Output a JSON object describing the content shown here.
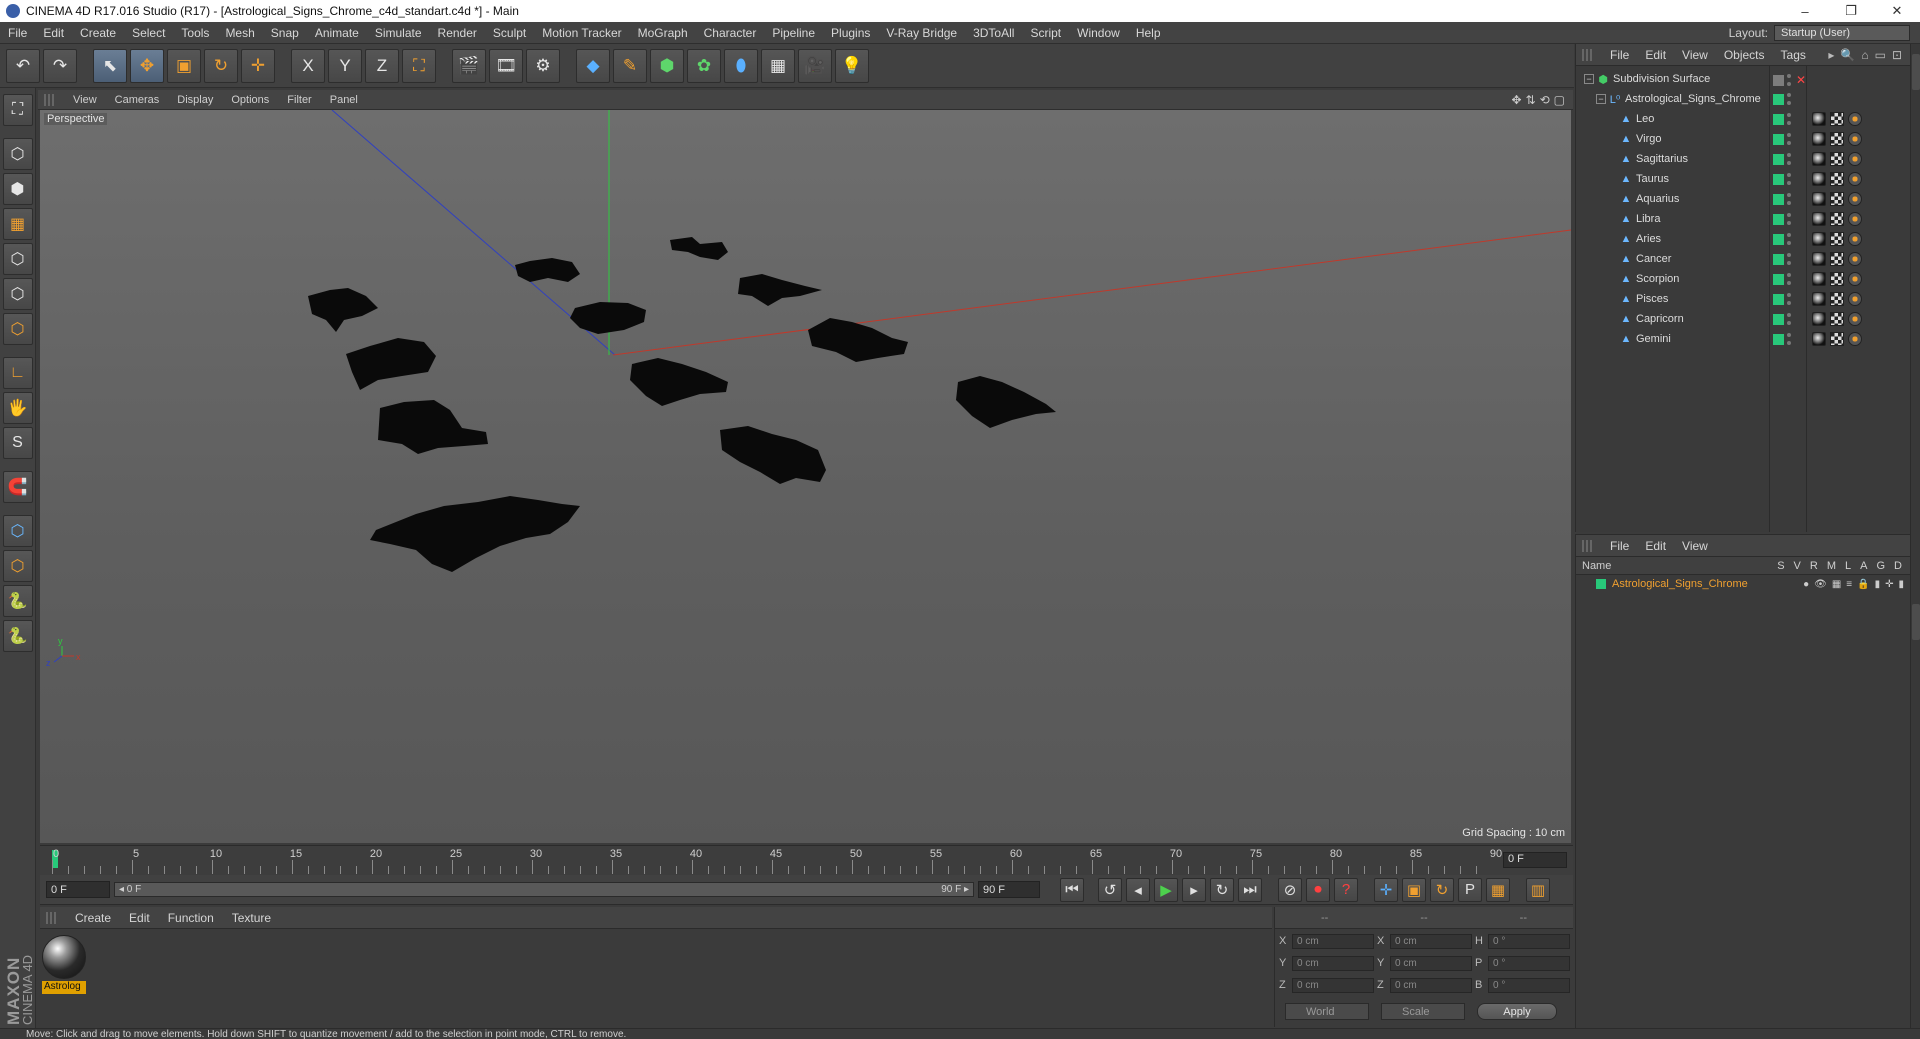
{
  "window": {
    "title": "CINEMA 4D R17.016 Studio (R17) - [Astrological_Signs_Chrome_c4d_standart.c4d *] - Main",
    "minimize_glyph": "–",
    "restore_glyph": "❐",
    "close_glyph": "✕"
  },
  "menubar": {
    "items": [
      "File",
      "Edit",
      "Create",
      "Select",
      "Tools",
      "Mesh",
      "Snap",
      "Animate",
      "Simulate",
      "Render",
      "Sculpt",
      "Motion Tracker",
      "MoGraph",
      "Character",
      "Pipeline",
      "Plugins",
      "V-Ray Bridge",
      "3DToAll",
      "Script",
      "Window",
      "Help"
    ],
    "layout_label": "Layout:",
    "layout_value": "Startup (User)"
  },
  "toolbar": {
    "undo": "↶",
    "redo": "↷",
    "select": "⬉",
    "move": "✥",
    "scale": "▣",
    "rotate": "↻",
    "recent": "✛",
    "x_axis": "X",
    "y_axis": "Y",
    "z_axis": "Z",
    "world": "⛶",
    "render_view": "🎬",
    "render_picture": "🎞",
    "render_settings": "⚙",
    "cube": "◆",
    "spline": "✎",
    "nurbs": "⬢",
    "array": "✿",
    "deformer": "⬮",
    "floor": "▦",
    "camera": "🎥",
    "light": "💡"
  },
  "lefttoolbar": {
    "icons": [
      "⛶",
      "⬡",
      "⬢",
      "▦",
      "⬡",
      "⬡",
      "⬡",
      "∟",
      "🖐",
      "S",
      "🧲",
      "⬡",
      "⬡",
      "🐍",
      "🐍"
    ]
  },
  "viewport": {
    "menus": [
      "View",
      "Cameras",
      "Display",
      "Options",
      "Filter",
      "Panel"
    ],
    "nav_icons": [
      "✥",
      "⇅",
      "⟲",
      "▢"
    ],
    "camera_label": "Perspective",
    "grid_spacing": "Grid Spacing : 10 cm",
    "axis_x": "x",
    "axis_y": "y",
    "axis_z": "z"
  },
  "timeline": {
    "ticks": [
      "0",
      "5",
      "10",
      "15",
      "20",
      "25",
      "30",
      "35",
      "40",
      "45",
      "50",
      "55",
      "60",
      "65",
      "70",
      "75",
      "80",
      "85",
      "90"
    ],
    "current_frame": "0 F"
  },
  "transport": {
    "start_field": "0 F",
    "range_start": "◂ 0 F",
    "range_end": "90 F ▸",
    "end_field": "90 F",
    "buttons": [
      "⏮",
      "↺",
      "◂",
      "▶",
      "▸",
      "↻",
      "⏭",
      "⊘",
      "⏺",
      "?",
      "✛",
      "▣",
      "↻",
      "P",
      "▦",
      "▥"
    ]
  },
  "material_manager": {
    "menus": [
      "Create",
      "Edit",
      "Function",
      "Texture"
    ],
    "material_name": "Astrolog"
  },
  "brand": {
    "maxon": "MAXON",
    "cinema": "CINEMA 4D"
  },
  "coordinates": {
    "headers": [
      "--",
      "--",
      "--"
    ],
    "rows": [
      {
        "a1": "X",
        "v1": "0 cm",
        "a2": "X",
        "v2": "0 cm",
        "a3": "H",
        "v3": "0 °"
      },
      {
        "a1": "Y",
        "v1": "0 cm",
        "a2": "Y",
        "v2": "0 cm",
        "a3": "P",
        "v3": "0 °"
      },
      {
        "a1": "Z",
        "v1": "0 cm",
        "a2": "Z",
        "v2": "0 cm",
        "a3": "B",
        "v3": "0 °"
      }
    ],
    "space": "World",
    "mode": "Scale",
    "apply": "Apply"
  },
  "object_manager": {
    "menus": [
      "File",
      "Edit",
      "View",
      "Objects",
      "Tags"
    ],
    "tool_icons": [
      "▸",
      "🔍",
      "⌂",
      "▭",
      "⊡"
    ],
    "root": "Subdivision Surface",
    "group": "Astrological_Signs_Chrome",
    "children": [
      "Leo",
      "Virgo",
      "Sagittarius",
      "Taurus",
      "Aquarius",
      "Libra",
      "Aries",
      "Cancer",
      "Scorpion",
      "Pisces",
      "Capricorn",
      "Gemini"
    ]
  },
  "layer_manager": {
    "menus": [
      "File",
      "Edit",
      "View"
    ],
    "name_header": "Name",
    "col_headers": [
      "S",
      "V",
      "R",
      "M",
      "L",
      "A",
      "G",
      "D"
    ],
    "layer_name": "Astrological_Signs_Chrome"
  },
  "status": {
    "text": "Move: Click and drag to move elements. Hold down SHIFT to quantize movement / add to the selection in point mode, CTRL to remove."
  },
  "colors": {
    "accent_orange": "#f0a030",
    "active_green": "#28c87a",
    "axis_x": "#c0392b",
    "axis_y": "#2ecc40",
    "axis_z": "#3040c0"
  }
}
